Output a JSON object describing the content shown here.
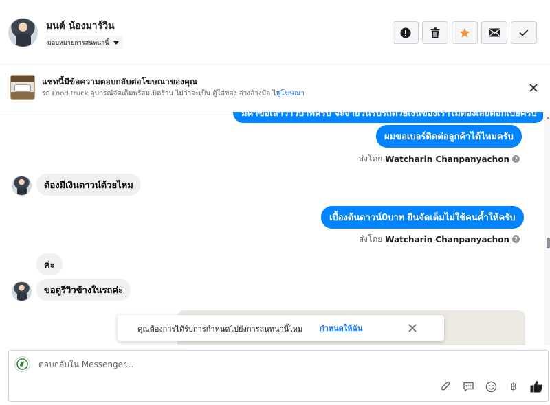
{
  "header": {
    "contact_name": "มนต์ น้องมาร์วิน",
    "assign_label": "มอบหมายการสนทนานี้",
    "actions": [
      "mark-spam",
      "delete",
      "star",
      "mark-unread",
      "done"
    ]
  },
  "ad_banner": {
    "title": "แชทนี้มีข้อความตอบกลับต่อโฆษณาของคุณ",
    "description": "รถ Food truck อุปกรณ์จัดเต็มพร้อมเปิดร้าน ไม่ว่าจะเป็น ตู้ใส่ของ อ่างล้างมือ ไฟ...",
    "link": "ดูโฆษณา"
  },
  "messages": {
    "m0_partial": "มีคำขอเล่าวาวบาทครับ จะจ่ายวันรับรถด้วยเงินของเราไม่ต้องเสียดอกเบี้ยครับ",
    "m1_out": "ผมขอเบอร์ติดต่อลูกค้าได้ไหมครับ",
    "sent_by_1_prefix": "ส่งโดย",
    "sent_by_1_name": "Watcharin Chanpanyachon",
    "m2_in": "ต้องมีเงินดาวน์ด้วยไหม",
    "m3_out": "เบื้องต้นดาวน์0บาท ยืนจัดเต็มไม่ใช้คนค้ำให้ครับ",
    "sent_by_2_prefix": "ส่งโดย",
    "sent_by_2_name": "Watcharin Chanpanyachon",
    "m4_in": "ค่ะ",
    "m5_in": "ขอดูรีวิวข้างในรถค่ะ"
  },
  "toast": {
    "text": "คุณต้องการได้รับการกำหนดไปยังการสนทนานี้ไหม",
    "link": "กำหนดให้ฉัน"
  },
  "composer": {
    "placeholder": "ตอบกลับใน Messenger...",
    "tools": [
      "attachment-icon",
      "saved-reply-icon",
      "emoji-icon",
      "payment-icon",
      "like-icon"
    ],
    "baht_symbol": "฿"
  },
  "colors": {
    "brand_blue": "#0084ff",
    "link_blue": "#1877f2",
    "star_orange": "#f7923b",
    "incoming_bubble": "#f0f0f0"
  }
}
